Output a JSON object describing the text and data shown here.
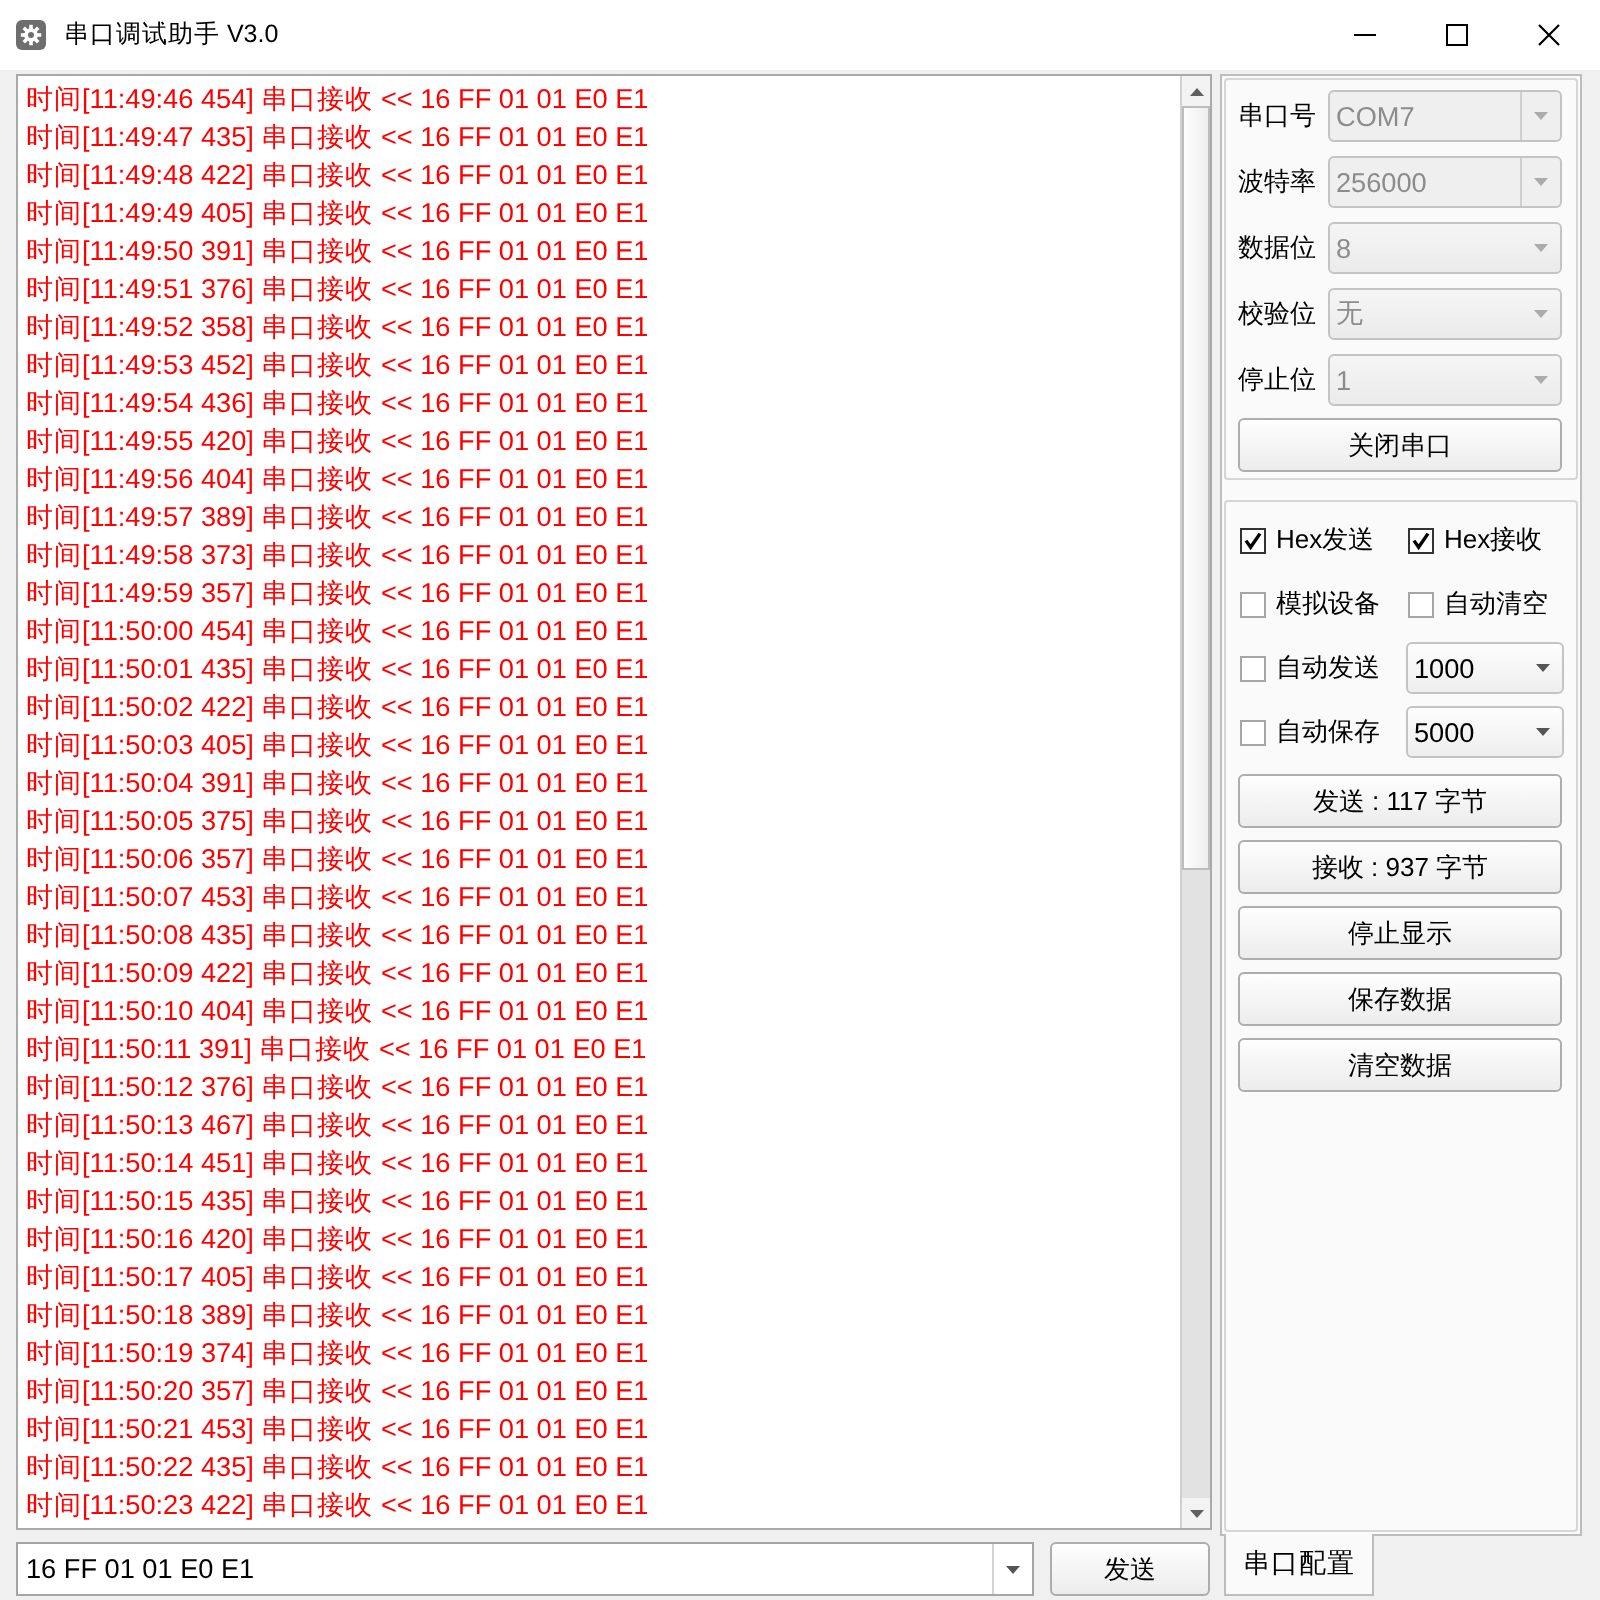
{
  "window": {
    "title": "串口调试助手 V3.0"
  },
  "log": {
    "lines": [
      "时间[11:49:46 454] 串口接收 << 16 FF 01 01 E0 E1",
      "时间[11:49:47 435] 串口接收 << 16 FF 01 01 E0 E1",
      "时间[11:49:48 422] 串口接收 << 16 FF 01 01 E0 E1",
      "时间[11:49:49 405] 串口接收 << 16 FF 01 01 E0 E1",
      "时间[11:49:50 391] 串口接收 << 16 FF 01 01 E0 E1",
      "时间[11:49:51 376] 串口接收 << 16 FF 01 01 E0 E1",
      "时间[11:49:52 358] 串口接收 << 16 FF 01 01 E0 E1",
      "时间[11:49:53 452] 串口接收 << 16 FF 01 01 E0 E1",
      "时间[11:49:54 436] 串口接收 << 16 FF 01 01 E0 E1",
      "时间[11:49:55 420] 串口接收 << 16 FF 01 01 E0 E1",
      "时间[11:49:56 404] 串口接收 << 16 FF 01 01 E0 E1",
      "时间[11:49:57 389] 串口接收 << 16 FF 01 01 E0 E1",
      "时间[11:49:58 373] 串口接收 << 16 FF 01 01 E0 E1",
      "时间[11:49:59 357] 串口接收 << 16 FF 01 01 E0 E1",
      "时间[11:50:00 454] 串口接收 << 16 FF 01 01 E0 E1",
      "时间[11:50:01 435] 串口接收 << 16 FF 01 01 E0 E1",
      "时间[11:50:02 422] 串口接收 << 16 FF 01 01 E0 E1",
      "时间[11:50:03 405] 串口接收 << 16 FF 01 01 E0 E1",
      "时间[11:50:04 391] 串口接收 << 16 FF 01 01 E0 E1",
      "时间[11:50:05 375] 串口接收 << 16 FF 01 01 E0 E1",
      "时间[11:50:06 357] 串口接收 << 16 FF 01 01 E0 E1",
      "时间[11:50:07 453] 串口接收 << 16 FF 01 01 E0 E1",
      "时间[11:50:08 435] 串口接收 << 16 FF 01 01 E0 E1",
      "时间[11:50:09 422] 串口接收 << 16 FF 01 01 E0 E1",
      "时间[11:50:10 404] 串口接收 << 16 FF 01 01 E0 E1",
      "时间[11:50:11 391] 串口接收 << 16 FF 01 01 E0 E1",
      "时间[11:50:12 376] 串口接收 << 16 FF 01 01 E0 E1",
      "时间[11:50:13 467] 串口接收 << 16 FF 01 01 E0 E1",
      "时间[11:50:14 451] 串口接收 << 16 FF 01 01 E0 E1",
      "时间[11:50:15 435] 串口接收 << 16 FF 01 01 E0 E1",
      "时间[11:50:16 420] 串口接收 << 16 FF 01 01 E0 E1",
      "时间[11:50:17 405] 串口接收 << 16 FF 01 01 E0 E1",
      "时间[11:50:18 389] 串口接收 << 16 FF 01 01 E0 E1",
      "时间[11:50:19 374] 串口接收 << 16 FF 01 01 E0 E1",
      "时间[11:50:20 357] 串口接收 << 16 FF 01 01 E0 E1",
      "时间[11:50:21 453] 串口接收 << 16 FF 01 01 E0 E1",
      "时间[11:50:22 435] 串口接收 << 16 FF 01 01 E0 E1",
      "时间[11:50:23 422] 串口接收 << 16 FF 01 01 E0 E1"
    ]
  },
  "port_settings": {
    "fields": [
      {
        "label": "串口号",
        "value": "COM7",
        "kind": "editable",
        "disabled": true
      },
      {
        "label": "波特率",
        "value": "256000",
        "kind": "editable",
        "disabled": true
      },
      {
        "label": "数据位",
        "value": "8",
        "kind": "select",
        "disabled": true
      },
      {
        "label": "校验位",
        "value": "无",
        "kind": "select",
        "disabled": true
      },
      {
        "label": "停止位",
        "value": "1",
        "kind": "select",
        "disabled": true
      }
    ],
    "button": "关闭串口"
  },
  "options": {
    "items": [
      {
        "kind": "checkbox",
        "label": "Hex发送",
        "checked": true
      },
      {
        "kind": "checkbox",
        "label": "Hex接收",
        "checked": true
      },
      {
        "kind": "checkbox",
        "label": "模拟设备",
        "checked": false
      },
      {
        "kind": "checkbox",
        "label": "自动清空",
        "checked": false
      },
      {
        "kind": "checkbox",
        "label": "自动发送",
        "checked": false
      },
      {
        "kind": "dropdown",
        "value": "1000"
      },
      {
        "kind": "checkbox",
        "label": "自动保存",
        "checked": false
      },
      {
        "kind": "dropdown",
        "value": "5000"
      }
    ],
    "buttons": [
      "发送 : 117 字节",
      "接收 : 937 字节",
      "停止显示",
      "保存数据",
      "清空数据"
    ]
  },
  "send_bar": {
    "input": {
      "value": "16 FF 01 01 E0 E1"
    },
    "button": "发送"
  },
  "tabs": [
    {
      "label": "串口配置",
      "selected": true
    }
  ]
}
